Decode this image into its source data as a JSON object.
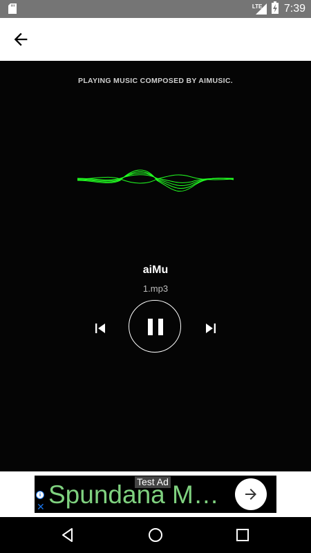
{
  "status_bar": {
    "time": "7:39",
    "network": "LTE",
    "icons": [
      "sd-card-icon",
      "signal-icon",
      "battery-charging-icon"
    ]
  },
  "app_bar": {
    "back_icon": "arrow-back-icon"
  },
  "player": {
    "header": "PLAYING MUSIC COMPOSED BY AIMUSIC.",
    "title": "aiMu",
    "filename": "1.mp3",
    "wave_color": "#22ff22",
    "controls": [
      "skip-previous-icon",
      "pause-icon",
      "skip-next-icon"
    ]
  },
  "ad": {
    "label": "Test Ad",
    "text": "Spundana M…",
    "text_color": "#7fd17f"
  },
  "nav_bar": {
    "buttons": [
      "back-triangle-icon",
      "home-circle-icon",
      "recents-square-icon"
    ]
  }
}
